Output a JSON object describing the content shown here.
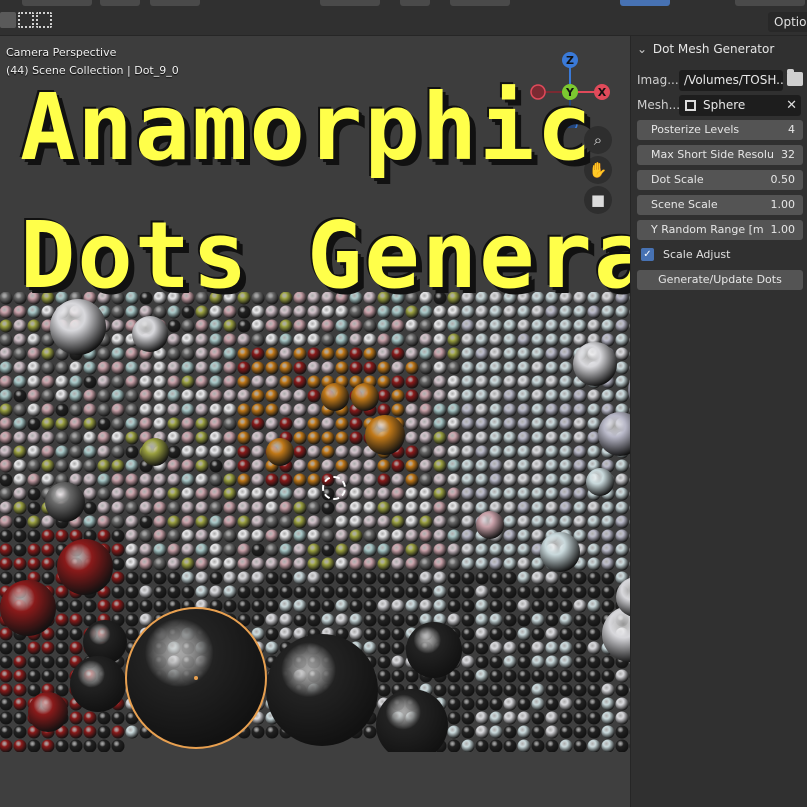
{
  "header": {
    "options_label": "Options"
  },
  "viewport": {
    "view_name": "Camera Perspective",
    "collection_info": "(44) Scene Collection | Dot_9_0",
    "gizmo": {
      "x_label": "X",
      "y_label": "Y",
      "z_label": "Z"
    },
    "nav_icons": [
      "zoom-icon",
      "hand-pan-icon",
      "camera-view-icon"
    ]
  },
  "overlay_title": {
    "line1": "Anamorphic",
    "line2": "Dots Generator"
  },
  "panel": {
    "title": "Dot Mesh Generator",
    "image_label": "Imag...",
    "image_path": "/Volumes/TOSH...",
    "mesh_label": "Mesh...",
    "mesh_value": "Sphere",
    "fields": [
      {
        "label": "Posterize Levels",
        "value": "4"
      },
      {
        "label": "Max Short Side Resolu",
        "value": "32"
      },
      {
        "label": "Dot Scale",
        "value": "0.50"
      },
      {
        "label": "Scene Scale",
        "value": "1.00"
      },
      {
        "label": "Y Random Range [m",
        "value": "1.00"
      }
    ],
    "checkbox_label": "Scale Adjust",
    "checkbox_checked": true,
    "generate_button": "Generate/Update Dots"
  },
  "colors": {
    "title_yellow": "#ffff4a",
    "panel_bg": "#303030",
    "viewport_bg": "#3d3d3d",
    "selected_outline": "#e8a050",
    "axis_x": "#e04a5a",
    "axis_y": "#7cc830",
    "axis_z": "#3a7ad8"
  }
}
